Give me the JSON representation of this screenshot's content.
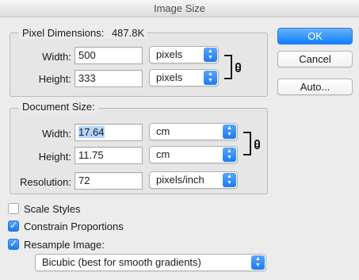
{
  "window": {
    "title": "Image Size"
  },
  "pixel_dimensions": {
    "legend": "Pixel Dimensions:",
    "size": "487.8K",
    "width_label": "Width:",
    "width_value": "500",
    "width_unit": "pixels",
    "height_label": "Height:",
    "height_value": "333",
    "height_unit": "pixels"
  },
  "document_size": {
    "legend": "Document Size:",
    "width_label": "Width:",
    "width_value": "17.64",
    "width_unit": "cm",
    "height_label": "Height:",
    "height_value": "11.75",
    "height_unit": "cm",
    "resolution_label": "Resolution:",
    "resolution_value": "72",
    "resolution_unit": "pixels/inch"
  },
  "buttons": {
    "ok": "OK",
    "cancel": "Cancel",
    "auto": "Auto..."
  },
  "options": {
    "scale_styles": {
      "label": "Scale Styles",
      "checked": false
    },
    "constrain_proportions": {
      "label": "Constrain Proportions",
      "checked": true
    },
    "resample_image": {
      "label": "Resample Image:",
      "checked": true
    },
    "resample_method": "Bicubic (best for smooth gradients)"
  },
  "colors": {
    "accent": "#1a7cf3",
    "selection": "#b5d5ff",
    "background": "#ececec"
  }
}
